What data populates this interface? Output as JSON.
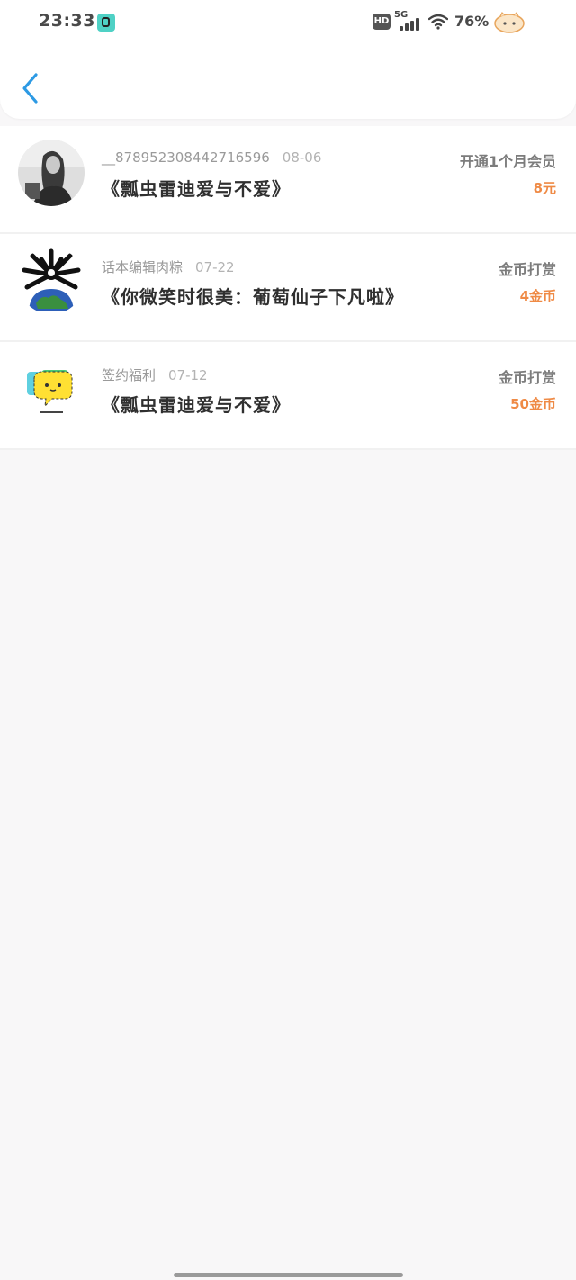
{
  "status_bar": {
    "time": "23:33",
    "hd_label": "HD",
    "network": "5G",
    "battery": "76%"
  },
  "colors": {
    "accent_back": "#2d9ae4",
    "amount": "#ef8a45"
  },
  "records": [
    {
      "user": "__878952308442716596",
      "date": "08-06",
      "title": "《瓢虫雷迪爱与不爱》",
      "action": "开通1个月会员",
      "amount": "8元",
      "avatar_icon": "portrait-avatar"
    },
    {
      "user": "话本编辑肉粽",
      "date": "07-22",
      "title": "《你微笑时很美：葡萄仙子下凡啦》",
      "action": "金币打赏",
      "amount": "4金币",
      "avatar_icon": "earth-spiky-avatar"
    },
    {
      "user": "签约福利",
      "date": "07-12",
      "title": "《瓢虫雷迪爱与不爱》",
      "action": "金币打赏",
      "amount": "50金币",
      "avatar_icon": "chat-bubble-avatar"
    }
  ]
}
